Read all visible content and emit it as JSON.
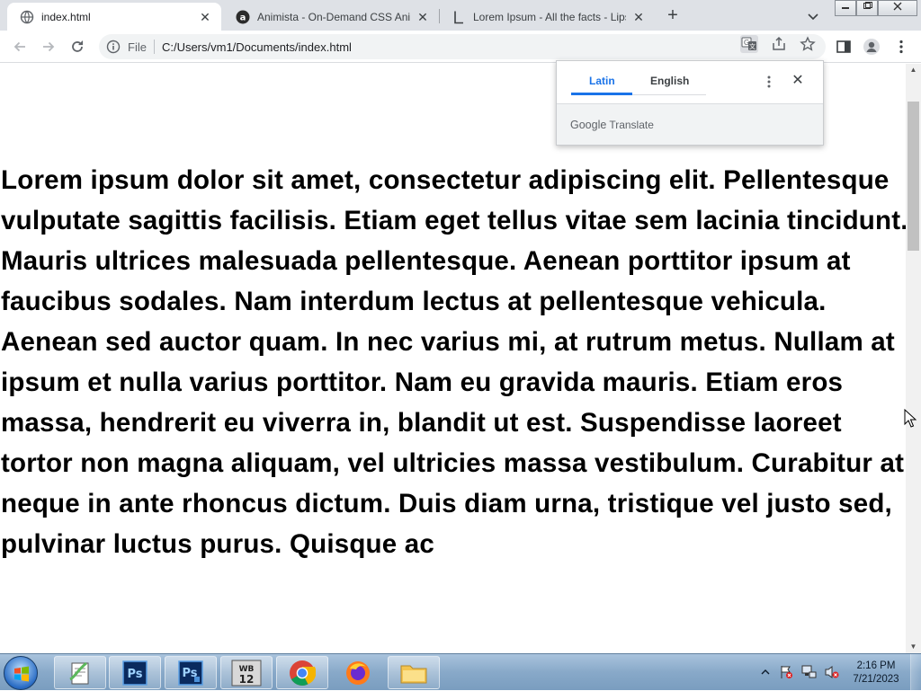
{
  "tabs": [
    {
      "title": "index.html",
      "favicon": "globe-icon",
      "active": true
    },
    {
      "title": "Animista - On-Demand CSS Anim",
      "favicon": "animista-icon",
      "active": false
    },
    {
      "title": "Lorem Ipsum - All the facts - Lips",
      "favicon": "lipsum-icon",
      "active": false
    }
  ],
  "toolbar": {
    "scheme": "File",
    "url": "C:/Users/vm1/Documents/index.html"
  },
  "content": {
    "text": "Lorem ipsum dolor sit amet, consectetur adipiscing elit. Pellentesque vulputate sagittis facilisis. Etiam eget tellus vitae sem lacinia tincidunt. Mauris ultrices malesuada pellentesque. Aenean porttitor ipsum at faucibus sodales. Nam interdum lectus at pellentesque vehicula. Aenean sed auctor quam. In nec varius mi, at rutrum metus. Nullam at ipsum et nulla varius porttitor. Nam eu gravida mauris. Etiam eros massa, hendrerit eu viverra in, blandit ut est. Suspendisse laoreet tortor non magna aliquam, vel ultricies massa vestibulum. Curabitur at neque in ante rhoncus dictum. Duis diam urna, tristique vel justo sed, pulvinar luctus purus. Quisque ac"
  },
  "translate": {
    "source_tab": "Latin",
    "target_tab": "English",
    "brand_google": "Google",
    "brand_translate": "Translate"
  },
  "taskbar": {
    "apps": [
      "notepad-plus-icon",
      "photoshop-icon",
      "photoshop-icon",
      "wb12-icon",
      "chrome-icon",
      "firefox-icon",
      "explorer-icon"
    ],
    "wb_label": "WB",
    "wb_number": "12",
    "ps_label": "Ps",
    "time": "2:16 PM",
    "date": "7/21/2023"
  },
  "colors": {
    "accent": "#1a73e8",
    "tabstrip": "#dee1e6",
    "omnibox": "#f1f3f4"
  }
}
